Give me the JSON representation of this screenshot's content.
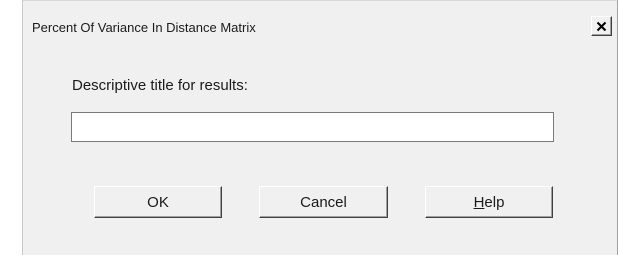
{
  "window": {
    "title": "Percent Of Variance In Distance Matrix",
    "close_label": "Close"
  },
  "form": {
    "title_label": "Descriptive title for results:",
    "title_value": "",
    "title_placeholder": ""
  },
  "buttons": {
    "ok_label": "OK",
    "cancel_label": "Cancel",
    "help_mnemonic": "H",
    "help_rest": "elp"
  },
  "icons": {
    "close": "close-icon"
  }
}
